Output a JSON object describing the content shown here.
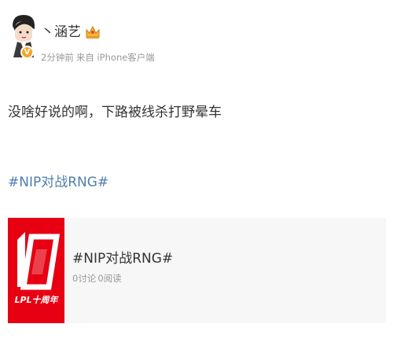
{
  "post": {
    "author": {
      "name": "丶涵艺",
      "verified_badge": "V",
      "avatar_icon": "cartoon-avatar-icon",
      "level_icon": "crown-icon"
    },
    "meta": {
      "time": "2分钟前",
      "source": "来自 iPhone客户端"
    },
    "text": "没啥好说的啊，下路被线杀打野晕车",
    "hashtag": "#NIP对战RNG#"
  },
  "topic_card": {
    "thumbnail_icon": "lpl-10-anniversary-logo-icon",
    "thumbnail_text": "LPL十周年",
    "title": "#NIP对战RNG#",
    "discussions": "0讨论",
    "reads": "0阅读"
  },
  "colors": {
    "link": "#507daf",
    "text": "#333333",
    "muted": "#999999",
    "card_bg": "#f7f7f7",
    "lpl_red": "#e60012",
    "badge": "#f5a623"
  }
}
